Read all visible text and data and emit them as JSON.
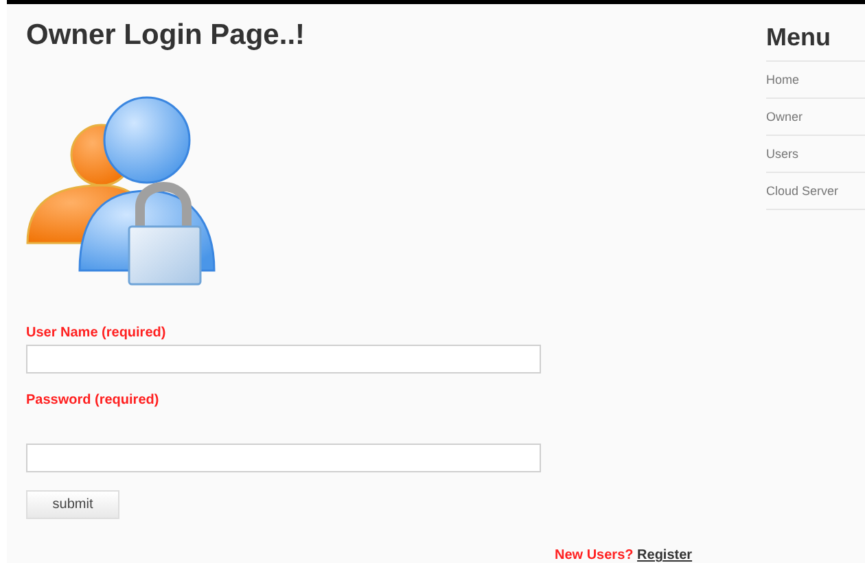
{
  "page_title": "Owner Login Page..!",
  "menu": {
    "title": "Menu",
    "items": [
      {
        "label": "Home"
      },
      {
        "label": "Owner"
      },
      {
        "label": "Users"
      },
      {
        "label": "Cloud Server"
      }
    ]
  },
  "form": {
    "fields": [
      {
        "label": "User Name (required)",
        "kind": "text"
      },
      {
        "label": "Password (required)",
        "kind": "password"
      }
    ],
    "submit": "submit",
    "register_prompt": "New Users?",
    "register_link": "Register"
  }
}
